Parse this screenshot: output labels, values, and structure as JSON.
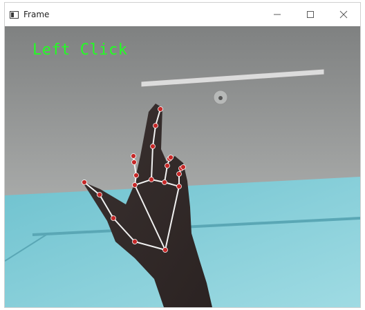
{
  "window": {
    "title": "Frame",
    "controls": {
      "minimize_icon": "minimize-icon",
      "maximize_icon": "maximize-icon",
      "close_icon": "close-icon"
    }
  },
  "frame": {
    "overlay_text": "Left Click",
    "overlay_color": "#22ff22",
    "landmark_color": "#c62828",
    "connection_color": "#f2f2f2"
  }
}
